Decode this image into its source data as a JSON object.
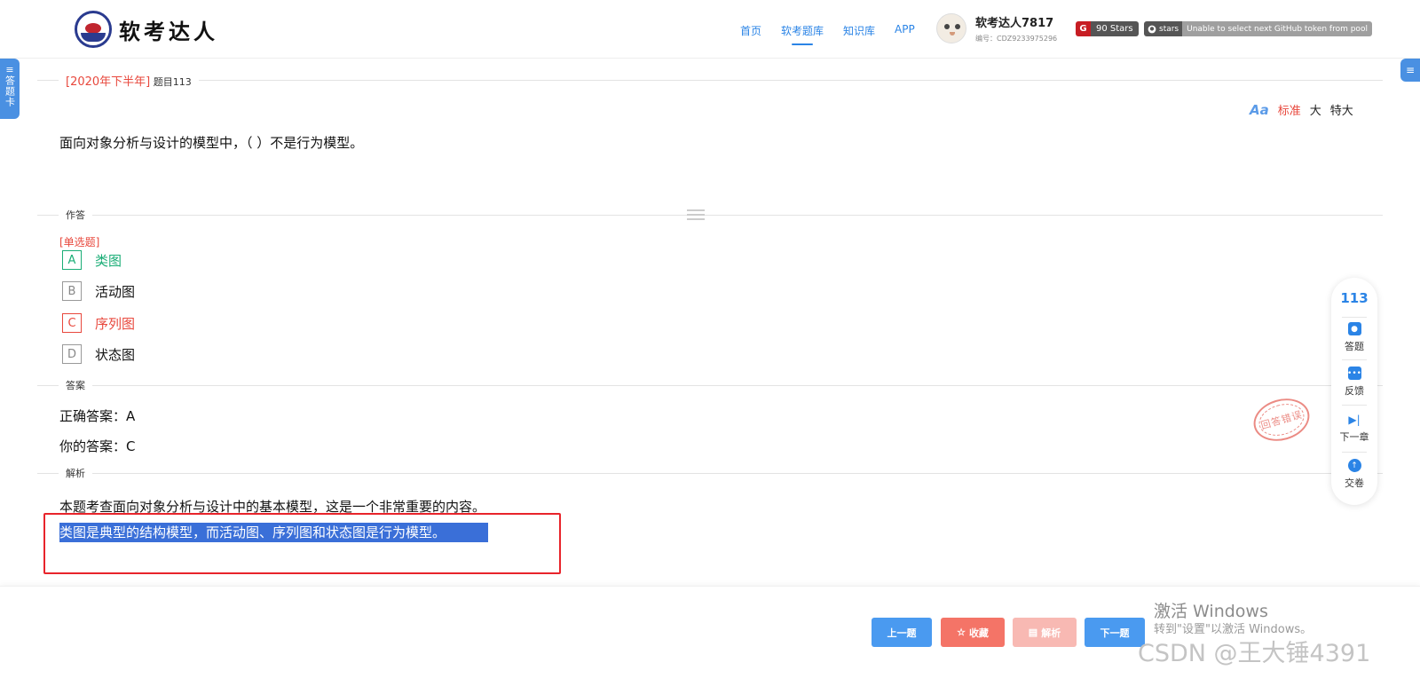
{
  "brand": {
    "name": "软考达人"
  },
  "nav": {
    "items": [
      {
        "label": "首页",
        "active": false
      },
      {
        "label": "软考题库",
        "active": true
      },
      {
        "label": "知识库",
        "active": false
      },
      {
        "label": "APP",
        "active": false
      }
    ]
  },
  "user": {
    "name": "软考达人7817",
    "id": "编号：CDZ9233975296"
  },
  "badges": {
    "stars_icon": "G",
    "stars_label": "90 Stars",
    "github_label": "stars",
    "github_error": "Unable to select next GitHub token from pool"
  },
  "side": {
    "answer_card_label": "答题卡",
    "menu_icon": "≡"
  },
  "question": {
    "year_tag": "[2020年下半年]",
    "number_label": "题目113",
    "text": "面向对象分析与设计的模型中，（ ）不是行为模型。",
    "type": "[单选题]"
  },
  "font_size": {
    "aa": "Aa",
    "options": [
      "标准",
      "大",
      "特大"
    ],
    "current": "标准"
  },
  "sections": {
    "answering": "作答",
    "answer": "答案",
    "analysis": "解析"
  },
  "options": [
    {
      "letter": "A",
      "text": "类图",
      "state": "correct"
    },
    {
      "letter": "B",
      "text": "活动图",
      "state": "normal"
    },
    {
      "letter": "C",
      "text": "序列图",
      "state": "wrong"
    },
    {
      "letter": "D",
      "text": "状态图",
      "state": "normal"
    }
  ],
  "answer": {
    "correct": "正确答案：A",
    "yours": "你的答案：C"
  },
  "stamp": "回答错误",
  "analysis": {
    "line1": "本题考查面向对象分析与设计中的基本模型，这是一个非常重要的内容。",
    "line2": "类图是典型的结构模型，而活动图、序列图和状态图是行为模型。"
  },
  "float_panel": {
    "number": "113",
    "items": [
      {
        "label": "答题",
        "icon": "shield-icon"
      },
      {
        "label": "反馈",
        "icon": "chat-icon"
      },
      {
        "label": "下一章",
        "icon": "skip-next-icon"
      },
      {
        "label": "交卷",
        "icon": "upload-icon"
      }
    ]
  },
  "buttons": {
    "prev": "上一题",
    "favorite": "收藏",
    "explain": "解析",
    "next": "下一题"
  },
  "watermark": {
    "activate_title": "激活 Windows",
    "activate_hint": "转到\"设置\"以激活 Windows。",
    "csdn": "CSDN @王大锤4391"
  },
  "colors": {
    "accent": "#2b84e6",
    "correct": "#1aad76",
    "wrong": "#e8483d",
    "highlight": "#3a6fd8"
  }
}
